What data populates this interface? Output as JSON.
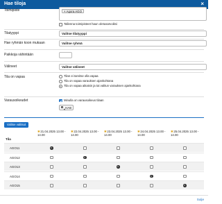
{
  "dialog": {
    "title": "Hae tiloja",
    "close_symbol": "×"
  },
  "form": {
    "rooms": {
      "label": "Toimipiste",
      "tag": "× Agora AGO",
      "checkbox_label": "Tallenna toimipisteet haun oletusarvoiksi",
      "checkbox_checked": false
    },
    "room_type": {
      "label": "Tilatyyppi",
      "value": "Valitse tilatyyppi"
    },
    "room_by_type": {
      "label": "Hae ryhmän koon mukaan",
      "value": "Valitse ryhmä"
    },
    "capacity": {
      "label": "Paikkoja vähintään",
      "value": ""
    },
    "equipment": {
      "label": "Välineet",
      "value": "Valitse välineet"
    },
    "status": {
      "label": "Tila on vapaa",
      "options": [
        {
          "text": "Tilan ei tarvitse olla vapaa",
          "selected": false
        },
        {
          "text": "Tila on vapaa varauksen ajankohtana",
          "selected": false
        },
        {
          "text": "Tila on vapaa aikaisin ja tai valitun varauksen ajankohtana",
          "selected": true
        }
      ]
    },
    "reservation": {
      "label": "Varausoikeudet",
      "checkbox_label": "Minulla on varausoikeus tilaan",
      "checkbox_checked": true
    },
    "search_button": "HAE"
  },
  "results": {
    "select_all_button": "Valitse valitsut",
    "tila_header": "Tila",
    "dates": [
      {
        "line1": "21.04.2025 13.00 -",
        "line2": "14.00"
      },
      {
        "line1": "22.04.2025 13.00 -",
        "line2": "14.00"
      },
      {
        "line1": "23.04.2025 13.00 -",
        "line2": "14.00"
      },
      {
        "line1": "24.04.2025 13.00 -",
        "line2": "14.00"
      },
      {
        "line1": "25.04.2025 13.00 -",
        "line2": "14.00"
      }
    ],
    "rows": [
      {
        "name": "AGO11",
        "states": [
          "selected",
          "empty",
          "empty",
          "empty",
          "empty"
        ]
      },
      {
        "name": "AGO12",
        "states": [
          "empty",
          "selected",
          "empty",
          "empty",
          "empty"
        ]
      },
      {
        "name": "AGO13",
        "states": [
          "empty",
          "empty",
          "selected",
          "empty",
          "empty"
        ]
      },
      {
        "name": "AGO14",
        "states": [
          "empty",
          "empty",
          "empty",
          "selected",
          "empty"
        ]
      },
      {
        "name": "AGO15",
        "states": [
          "empty",
          "empty",
          "empty",
          "empty",
          "selected"
        ]
      }
    ]
  },
  "footer": {
    "close_link": "Sulje"
  },
  "colors": {
    "header_bg": "#0d5a9e",
    "accent": "#1a6fc4",
    "star": "#d9a21b"
  }
}
